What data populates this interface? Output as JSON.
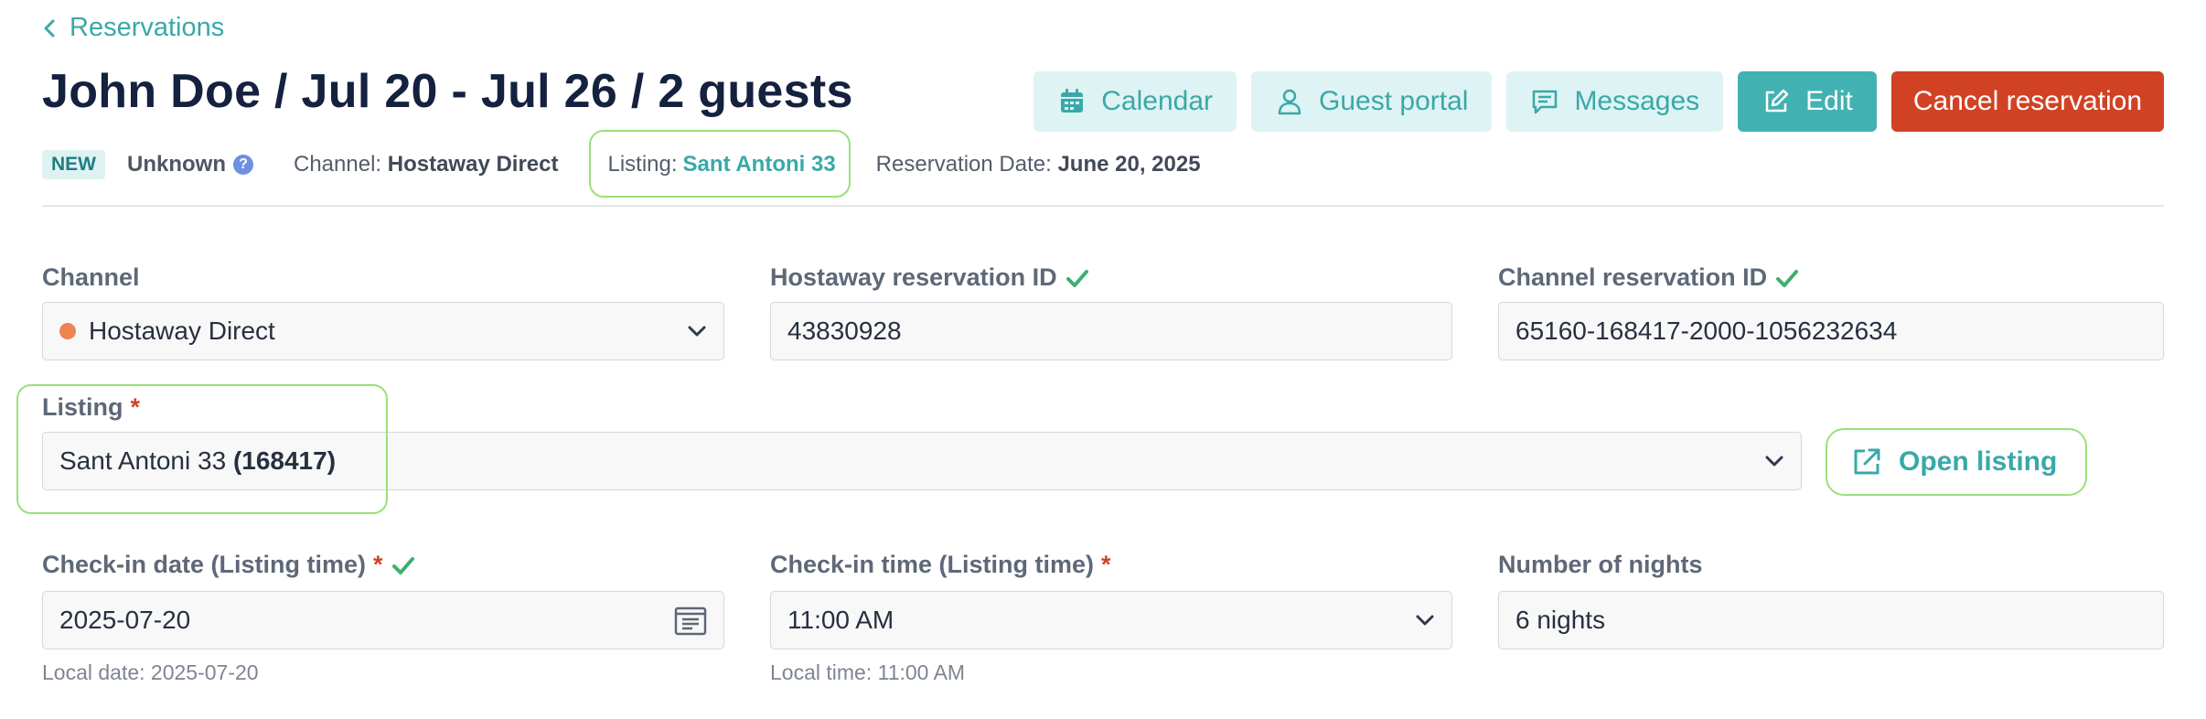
{
  "nav": {
    "back_label": "Reservations"
  },
  "header": {
    "title": "John Doe / Jul 20 - Jul 26 / 2 guests",
    "actions": {
      "calendar": "Calendar",
      "guest_portal": "Guest portal",
      "messages": "Messages",
      "edit": "Edit",
      "cancel": "Cancel reservation"
    }
  },
  "meta": {
    "status_badge": "NEW",
    "verification": "Unknown",
    "help_glyph": "?",
    "channel_label": "Channel:",
    "channel_value": "Hostaway Direct",
    "listing_label": "Listing:",
    "listing_value": "Sant Antoni 33",
    "reservation_date_label": "Reservation Date:",
    "reservation_date_value": "June 20, 2025"
  },
  "form": {
    "channel": {
      "label": "Channel",
      "value": "Hostaway Direct",
      "dot_color": "#ee8450"
    },
    "hostaway_id": {
      "label": "Hostaway reservation ID",
      "value": "43830928"
    },
    "channel_reservation_id": {
      "label": "Channel reservation ID",
      "value": "65160-168417-2000-1056232634"
    },
    "listing": {
      "label": "Listing",
      "required_mark": "*",
      "name": "Sant Antoni 33",
      "id": "(168417)",
      "open_label": "Open listing"
    },
    "checkin_date": {
      "label": "Check-in date (Listing time)",
      "required_mark": "*",
      "value": "2025-07-20",
      "hint": "Local date: 2025-07-20"
    },
    "checkin_time": {
      "label": "Check-in time (Listing time)",
      "required_mark": "*",
      "value": "11:00 AM",
      "hint": "Local time: 11:00 AM"
    },
    "nights": {
      "label": "Number of nights",
      "value": "6 nights"
    }
  },
  "colors": {
    "accent": "#3aa8a8",
    "primary_button": "#42b1b1",
    "danger_button": "#d14224",
    "success_check": "#3fae6f",
    "annotation_outline": "#9ae07a"
  }
}
